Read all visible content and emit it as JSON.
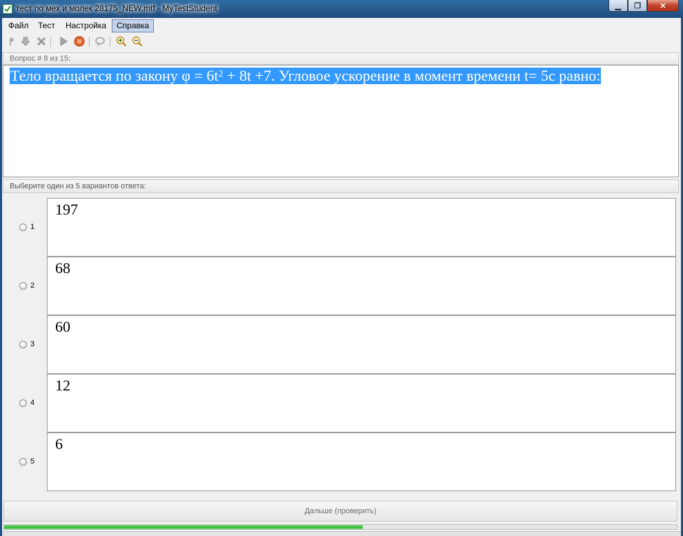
{
  "window": {
    "title": "тест по мех и молек 28175_NEW.mtf - MyTestStudent",
    "min_label": "▁",
    "max_label": "❐",
    "close_label": "✕"
  },
  "menu": [
    {
      "label": "Файл"
    },
    {
      "label": "Тест"
    },
    {
      "label": "Настройка"
    },
    {
      "label": "Справка",
      "active": true
    }
  ],
  "toolbar": {
    "icons": [
      "hand-icon",
      "arrow-down-icon",
      "cross-icon",
      "play-icon",
      "stop-icon",
      "chat-icon",
      "zoom-in-icon",
      "zoom-out-icon"
    ]
  },
  "question": {
    "header": "Вопрос # 8 из 15:",
    "text_before": "Тело вращается по закону φ = 6t",
    "superscript": "2",
    "text_after": " + 8t +7. Угловое ускорение в момент времени t= 5с равно:"
  },
  "answers": {
    "header": "Выберите один из 5 вариантов ответа:",
    "items": [
      {
        "num": "1",
        "text": "197"
      },
      {
        "num": "2",
        "text": "68"
      },
      {
        "num": "3",
        "text": "60"
      },
      {
        "num": "4",
        "text": "12"
      },
      {
        "num": "5",
        "text": "6"
      }
    ]
  },
  "next_button": {
    "label": "Дальше (проверить)"
  },
  "progress": {
    "fraction": 0.533
  },
  "colors": {
    "selection": "#3399ff",
    "progress": "#2fb82f",
    "title_bar": "#2a5f93"
  }
}
